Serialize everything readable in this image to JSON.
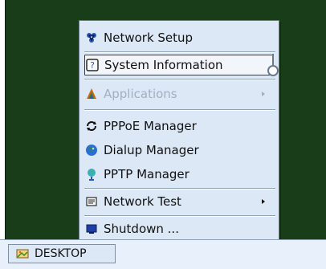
{
  "menu": {
    "items": [
      {
        "key": "network_setup",
        "label": "Network Setup",
        "icon": "network-setup-icon",
        "enabled": true,
        "selected": false,
        "has_submenu": false
      },
      {
        "key": "system_information",
        "label": "System Information",
        "icon": "system-information-icon",
        "enabled": true,
        "selected": true,
        "has_submenu": false
      },
      {
        "key": "applications",
        "label": "Applications",
        "icon": "applications-icon",
        "enabled": false,
        "selected": false,
        "has_submenu": true
      },
      {
        "key": "pppoe_manager",
        "label": "PPPoE Manager",
        "icon": "pppoe-manager-icon",
        "enabled": true,
        "selected": false,
        "has_submenu": false
      },
      {
        "key": "dialup_manager",
        "label": "Dialup Manager",
        "icon": "dialup-manager-icon",
        "enabled": true,
        "selected": false,
        "has_submenu": false
      },
      {
        "key": "pptp_manager",
        "label": "PPTP Manager",
        "icon": "pptp-manager-icon",
        "enabled": true,
        "selected": false,
        "has_submenu": false
      },
      {
        "key": "network_test",
        "label": "Network Test",
        "icon": "network-test-icon",
        "enabled": true,
        "selected": false,
        "has_submenu": true
      },
      {
        "key": "shutdown",
        "label": "Shutdown ...",
        "icon": "shutdown-icon",
        "enabled": true,
        "selected": false,
        "has_submenu": false
      }
    ]
  },
  "taskbar": {
    "desktop_label": "DESKTOP",
    "desktop_icon": "desktop-icon"
  },
  "colors": {
    "desktop_bg": "#193d19",
    "menu_bg": "#dce8f6",
    "menu_border": "#6b7a8b",
    "taskbar_bg": "#e8f1fb",
    "disabled_text": "#9fb0c3"
  }
}
